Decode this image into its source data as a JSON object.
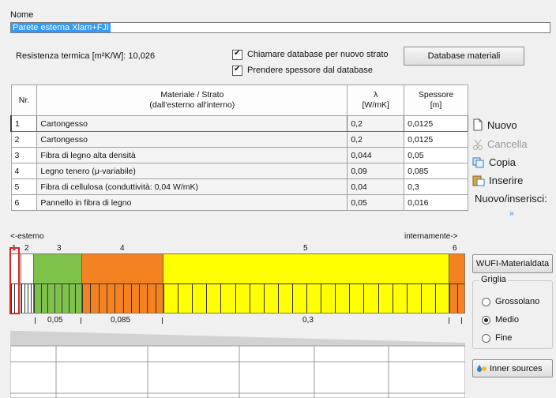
{
  "name": {
    "label": "Nome",
    "value": "Parete esterna Xlam+FJI"
  },
  "resistance": {
    "text": "Resistenza termica  [m²K/W]: 10,026"
  },
  "options": {
    "call_db_label": "Chiamare database per nuovo strato",
    "call_db_checked": true,
    "take_thickness_label": "Prendere spessore dal database",
    "take_thickness_checked": true
  },
  "db_button": "Database materiali",
  "table": {
    "headers": {
      "nr": "Nr.",
      "material_line1": "Materiale / Strato",
      "material_line2": "(dall'esterno all'interno)",
      "lambda_line1": "λ",
      "lambda_line2": "[W/mK]",
      "thickness_line1": "Spessore",
      "thickness_line2": "[m]"
    },
    "rows": [
      {
        "nr": "1",
        "material": "Cartongesso",
        "lambda": "0,2",
        "thickness": "0,0125"
      },
      {
        "nr": "2",
        "material": "Cartongesso",
        "lambda": "0,2",
        "thickness": "0,0125"
      },
      {
        "nr": "3",
        "material": "Fibra di legno alta densità",
        "lambda": "0,044",
        "thickness": "0,05"
      },
      {
        "nr": "4",
        "material": "Legno tenero (μ-variabile)",
        "lambda": "0,09",
        "thickness": "0,085"
      },
      {
        "nr": "5",
        "material": "Fibra di cellulosa (conduttività: 0,04 W/mK)",
        "lambda": "0,04",
        "thickness": "0,3"
      },
      {
        "nr": "6",
        "material": "Pannello in fibra di legno",
        "lambda": "0,05",
        "thickness": "0,016"
      }
    ]
  },
  "actions": {
    "new": "Nuovo",
    "delete": "Cancella",
    "copy": "Copia",
    "insert": "Inserire",
    "new_insert": "Nuovo/inserisci:",
    "more": "»"
  },
  "diagram": {
    "left_label": "<-esterno",
    "right_label": "internamente->",
    "layer_numbers": [
      "1",
      "2",
      "3",
      "4",
      "5",
      "6"
    ],
    "dimension_labels": [
      "0,05",
      "0,085",
      "0,3"
    ],
    "colors": {
      "layer1": "#ffffff",
      "layer2": "#ffffff",
      "layer3": "#7fc24a",
      "layer4": "#f58220",
      "layer5": "#ffff00",
      "layer6": "#f58220",
      "selection": "#e02020"
    }
  },
  "wufi_button": "WUFI-Materialdata",
  "grid": {
    "legend": "Griglia",
    "options": [
      "Grossolano",
      "Medio",
      "Fine"
    ],
    "selected": "Medio"
  },
  "inner_sources_button": "Inner sources"
}
